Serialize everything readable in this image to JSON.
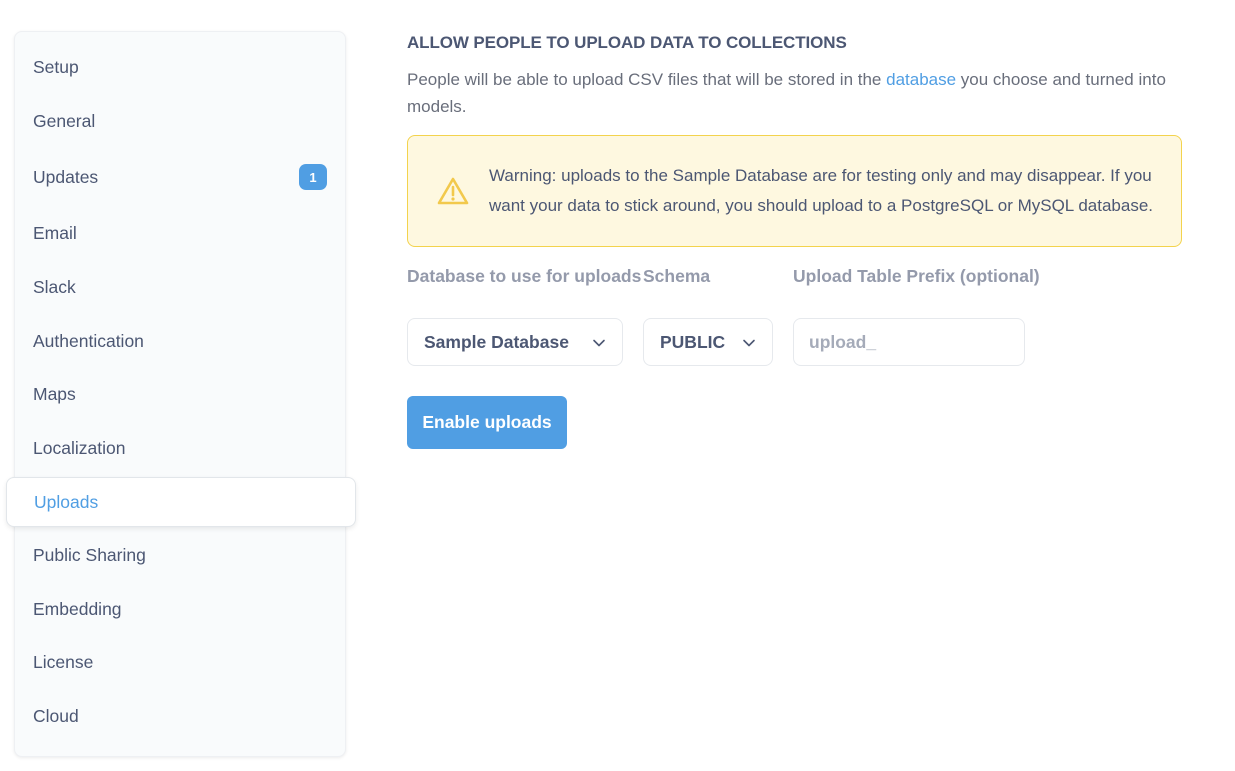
{
  "sidebar": {
    "items": [
      {
        "label": "Setup"
      },
      {
        "label": "General"
      },
      {
        "label": "Updates",
        "badge": "1"
      },
      {
        "label": "Email"
      },
      {
        "label": "Slack"
      },
      {
        "label": "Authentication"
      },
      {
        "label": "Maps"
      },
      {
        "label": "Localization"
      },
      {
        "label": "Uploads",
        "active": true
      },
      {
        "label": "Public Sharing"
      },
      {
        "label": "Embedding"
      },
      {
        "label": "License"
      },
      {
        "label": "Cloud"
      }
    ]
  },
  "main": {
    "heading": "ALLOW PEOPLE TO UPLOAD DATA TO COLLECTIONS",
    "desc_before": "People will be able to upload CSV files that will be stored in the ",
    "desc_link": "database",
    "desc_after": " you choose and turned into models.",
    "warning": {
      "icon": "warning-triangle-icon",
      "text": "Warning: uploads to the Sample Database are for testing only and may disappear. If you want your data to stick around, you should upload to a PostgreSQL or MySQL database."
    },
    "fields": {
      "database_label": "Database to use for uploads",
      "database_value": "Sample Database",
      "schema_label": "Schema",
      "schema_value": "PUBLIC",
      "prefix_label": "Upload Table Prefix (optional)",
      "prefix_placeholder": "upload_"
    },
    "enable_button": "Enable uploads"
  },
  "colors": {
    "accent": "#509ee3",
    "warning_bg": "#fef8e0",
    "warning_border": "#f3d34d",
    "warning_icon": "#f2c94c"
  }
}
